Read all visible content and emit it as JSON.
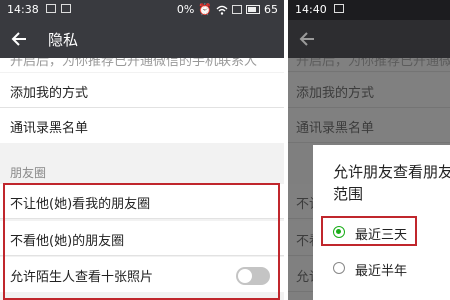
{
  "left": {
    "status": {
      "time": "14:38",
      "battery": "0%",
      "battery_level": "65"
    },
    "title": "隐私",
    "cut_text": "开启后，为你推荐已开通微信的手机联系人",
    "items": [
      {
        "label": "添加我的方式"
      },
      {
        "label": "通讯录黑名单"
      }
    ],
    "group_label": "朋友圈",
    "moments": [
      {
        "label": "不让他(她)看我的朋友圈"
      },
      {
        "label": "不看他(她)的朋友圈"
      },
      {
        "label": "允许陌生人查看十张照片",
        "toggle_on": false
      }
    ]
  },
  "right": {
    "status": {
      "time": "14:40"
    },
    "dim_rows": [
      {
        "label": "不让"
      },
      {
        "label": "不看"
      },
      {
        "label": "允许"
      }
    ],
    "dialog": {
      "title": "允许朋友查看朋友圈的范围",
      "options": [
        {
          "label": "最近三天",
          "selected": true
        },
        {
          "label": "最近半年",
          "selected": false
        }
      ]
    }
  },
  "colors": {
    "title_bar": "#393a3f",
    "highlight_border": "#c0262c",
    "radio_selected": "#1aad19"
  }
}
